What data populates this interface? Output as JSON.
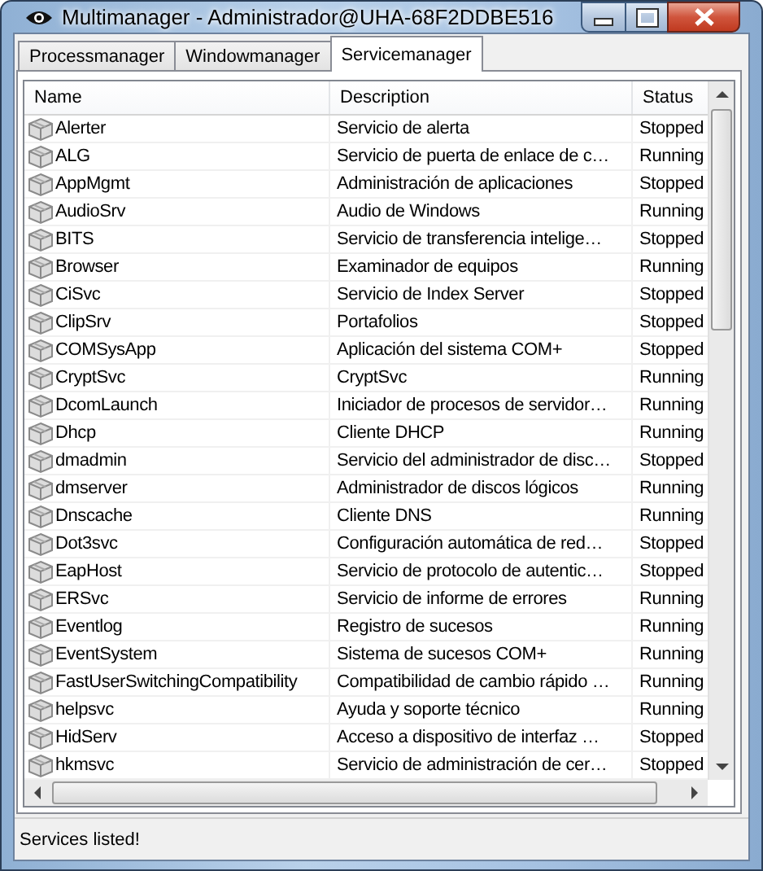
{
  "window": {
    "title": "Multimanager - Administrador@UHA-68F2DDBE516"
  },
  "tabs": [
    {
      "label": "Processmanager",
      "selected": false
    },
    {
      "label": "Windowmanager",
      "selected": false
    },
    {
      "label": "Servicemanager",
      "selected": true
    }
  ],
  "table": {
    "columns": [
      "Name",
      "Description",
      "Status"
    ],
    "rows": [
      {
        "name": "Alerter",
        "description": "Servicio de alerta",
        "status": "Stopped"
      },
      {
        "name": "ALG",
        "description": "Servicio de puerta de enlace de c…",
        "status": "Running"
      },
      {
        "name": "AppMgmt",
        "description": "Administración de aplicaciones",
        "status": "Stopped"
      },
      {
        "name": "AudioSrv",
        "description": "Audio de Windows",
        "status": "Running"
      },
      {
        "name": "BITS",
        "description": "Servicio de transferencia intelige…",
        "status": "Stopped"
      },
      {
        "name": "Browser",
        "description": "Examinador de equipos",
        "status": "Running"
      },
      {
        "name": "CiSvc",
        "description": "Servicio de Index Server",
        "status": "Stopped"
      },
      {
        "name": "ClipSrv",
        "description": "Portafolios",
        "status": "Stopped"
      },
      {
        "name": "COMSysApp",
        "description": "Aplicación del sistema COM+",
        "status": "Stopped"
      },
      {
        "name": "CryptSvc",
        "description": "CryptSvc",
        "status": "Running"
      },
      {
        "name": "DcomLaunch",
        "description": "Iniciador de procesos de servidor…",
        "status": "Running"
      },
      {
        "name": "Dhcp",
        "description": "Cliente DHCP",
        "status": "Running"
      },
      {
        "name": "dmadmin",
        "description": "Servicio del administrador de disc…",
        "status": "Stopped"
      },
      {
        "name": "dmserver",
        "description": "Administrador de discos lógicos",
        "status": "Running"
      },
      {
        "name": "Dnscache",
        "description": "Cliente DNS",
        "status": "Running"
      },
      {
        "name": "Dot3svc",
        "description": "Configuración automática de red…",
        "status": "Stopped"
      },
      {
        "name": "EapHost",
        "description": "Servicio de protocolo de autentic…",
        "status": "Stopped"
      },
      {
        "name": "ERSvc",
        "description": "Servicio de informe de errores",
        "status": "Running"
      },
      {
        "name": "Eventlog",
        "description": "Registro de sucesos",
        "status": "Running"
      },
      {
        "name": "EventSystem",
        "description": "Sistema de sucesos COM+",
        "status": "Running"
      },
      {
        "name": "FastUserSwitchingCompatibility",
        "description": "Compatibilidad de cambio rápido …",
        "status": "Running"
      },
      {
        "name": "helpsvc",
        "description": "Ayuda y soporte técnico",
        "status": "Running"
      },
      {
        "name": "HidServ",
        "description": "Acceso a dispositivo de interfaz …",
        "status": "Stopped"
      },
      {
        "name": "hkmsvc",
        "description": "Servicio de administración de cer…",
        "status": "Stopped"
      }
    ]
  },
  "status_bar": "Services listed!"
}
